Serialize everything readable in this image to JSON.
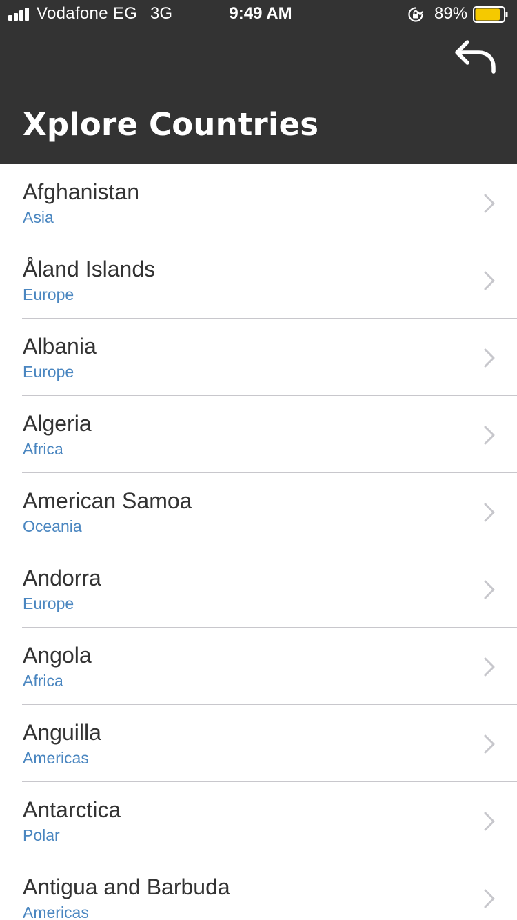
{
  "status_bar": {
    "carrier": "Vodafone EG",
    "network": "3G",
    "time": "9:49 AM",
    "battery_percent": "89%",
    "battery_level": 0.89,
    "battery_color": "#f5c900",
    "icons": [
      "signal-bars-icon",
      "orientation-lock-icon",
      "battery-icon"
    ]
  },
  "nav": {
    "title": "Xplore Countries",
    "back_icon": "reply-arrow-icon",
    "background": "#333333"
  },
  "colors": {
    "region_text": "#4a86c0",
    "name_text": "#333333",
    "chevron": "#c7c7cc"
  },
  "countries": [
    {
      "name": "Afghanistan",
      "region": "Asia"
    },
    {
      "name": "Åland Islands",
      "region": "Europe"
    },
    {
      "name": "Albania",
      "region": "Europe"
    },
    {
      "name": "Algeria",
      "region": "Africa"
    },
    {
      "name": "American Samoa",
      "region": "Oceania"
    },
    {
      "name": "Andorra",
      "region": "Europe"
    },
    {
      "name": "Angola",
      "region": "Africa"
    },
    {
      "name": "Anguilla",
      "region": "Americas"
    },
    {
      "name": "Antarctica",
      "region": "Polar"
    },
    {
      "name": "Antigua and Barbuda",
      "region": "Americas"
    }
  ]
}
